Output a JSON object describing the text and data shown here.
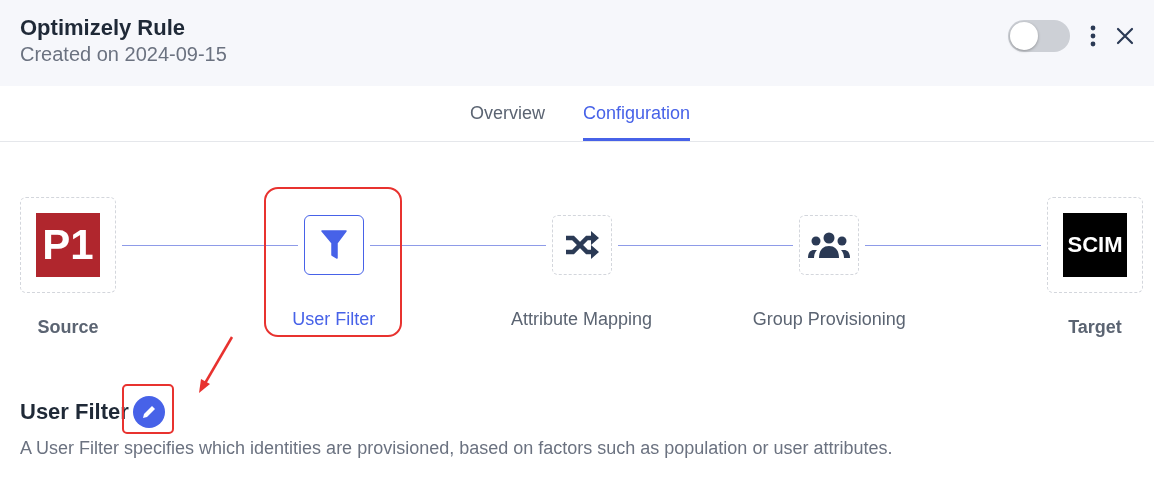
{
  "header": {
    "title": "Optimizely Rule",
    "subtitle": "Created on 2024-09-15",
    "toggle": {
      "on": false
    }
  },
  "tabs": [
    {
      "label": "Overview",
      "selected": false
    },
    {
      "label": "Configuration",
      "selected": true
    }
  ],
  "pipeline": [
    {
      "kind": "p1",
      "logo_text": "P1",
      "label": "Source",
      "selected": false,
      "annotated": false
    },
    {
      "kind": "filter",
      "label": "User Filter",
      "selected": true,
      "annotated": true
    },
    {
      "kind": "shuffle",
      "label": "Attribute Mapping",
      "selected": false,
      "annotated": false
    },
    {
      "kind": "group",
      "label": "Group Provisioning",
      "selected": false,
      "annotated": false
    },
    {
      "kind": "scim",
      "logo_text": "SCIM",
      "label": "Target",
      "selected": false,
      "annotated": false
    }
  ],
  "section": {
    "title": "User Filter",
    "edit_annotated": true,
    "description": "A User Filter specifies which identities are provisioned, based on factors such as population or user attributes."
  }
}
